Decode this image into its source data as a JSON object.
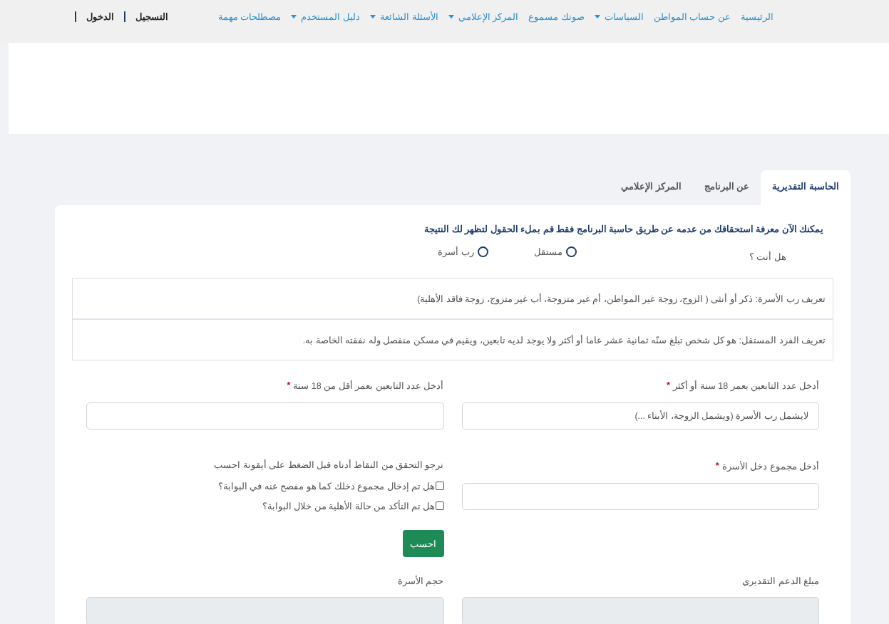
{
  "nav": {
    "items": [
      {
        "label": "الرئيسية",
        "dropdown": false
      },
      {
        "label": "عن حساب المواطن",
        "dropdown": false
      },
      {
        "label": "السياسات",
        "dropdown": true
      },
      {
        "label": "صوتك مسموع",
        "dropdown": false
      },
      {
        "label": "المركز الإعلامي",
        "dropdown": true
      },
      {
        "label": "الأسئلة الشائعة",
        "dropdown": true
      },
      {
        "label": "دليل المستخدم",
        "dropdown": true
      },
      {
        "label": "مصطلحات مهمة",
        "dropdown": false
      }
    ],
    "auth": [
      {
        "label": "التسجيل"
      },
      {
        "label": "الدخول"
      }
    ]
  },
  "tabs": [
    {
      "label": "الحاسبة التقديرية",
      "selected": true
    },
    {
      "label": "عن البرنامج",
      "selected": false
    },
    {
      "label": "المركز الإعلامي",
      "selected": false
    }
  ],
  "calculator": {
    "intro": "يمكنك الآن معرفة استحقاقك من عدمه عن طريق حاسبة البرنامج فقط قم بملء الحقول لتظهر لك النتيجة",
    "question": "هل أنت ؟",
    "options": [
      {
        "label": "مستقل",
        "selected": false
      },
      {
        "label": "رب أسرة",
        "selected": false
      }
    ],
    "definitions": [
      "تعريف رب الأسرة: ذكر أو أنثى ( الزوج، زوجة غير المواطن، أم غير متزوجة، أب غير متزوج، زوجة فاقد الأهلية)",
      "تعريف الفرد المستقل: هو كل شخص تبلغ سنّه ثمانية عشر عاما أو أكثر ولا يوجد لديه تابعين، ويقيم في مسكن منفصل وله نفقته الخاصة به."
    ],
    "fields": [
      {
        "label": "أدخل عدد التابعين بعمر 18 سنة أو أكثر",
        "mark": "*",
        "placeholder": "لايشمل رب الأسرة (ويشمل الزوجة، الأبناء ...)"
      },
      {
        "label": "أدخل عدد التابعين بعمر أقل من 18 سنة",
        "mark": "*"
      },
      {
        "label": "أدخل مجموع دخل الأسرة",
        "mark": "*"
      }
    ],
    "checks": {
      "note": "نرجو التحقق من النقاط أدناه قبل الضغط على أيقونة احسب",
      "items": [
        {
          "label": "هل تم إدخال مجموع دخلك كما هو مفصح عنه في البوابة؟",
          "checked": false
        },
        {
          "label": "هل تم التأكد من حالة الأهلية من خلال البوابة؟",
          "checked": false
        }
      ]
    },
    "button": "احسب",
    "results": [
      {
        "label": "مبلغ الدعم التقديري"
      },
      {
        "label": "حجم الأسرة"
      }
    ]
  }
}
